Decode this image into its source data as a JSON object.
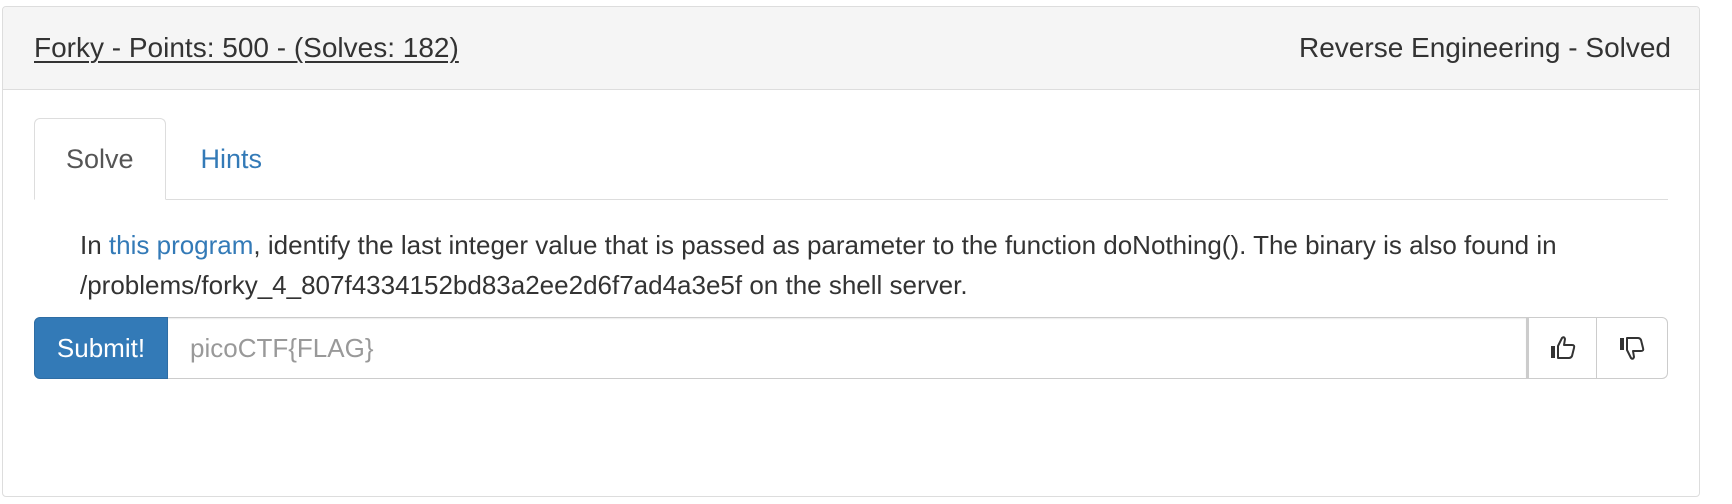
{
  "problem": {
    "title": "Forky - Points: 500 - (Solves: 182)",
    "category_status": "Reverse Engineering - Solved"
  },
  "tabs": [
    {
      "label": "Solve",
      "active": true
    },
    {
      "label": "Hints",
      "active": false
    }
  ],
  "description": {
    "prefix": "In ",
    "link_text": "this program",
    "suffix": ", identify the last integer value that is passed as parameter to the function doNothing(). The binary is also found in /problems/forky_4_807f4334152bd83a2ee2d6f7ad4a3e5f on the shell server."
  },
  "submit": {
    "button_label": "Submit!",
    "input_value": "",
    "input_placeholder": "picoCTF{FLAG}"
  },
  "icons": {
    "upvote": "thumbs-up-icon",
    "downvote": "thumbs-down-icon"
  },
  "colors": {
    "primary": "#337ab7",
    "heading_bg": "#f5f5f5",
    "border": "#dddddd"
  }
}
